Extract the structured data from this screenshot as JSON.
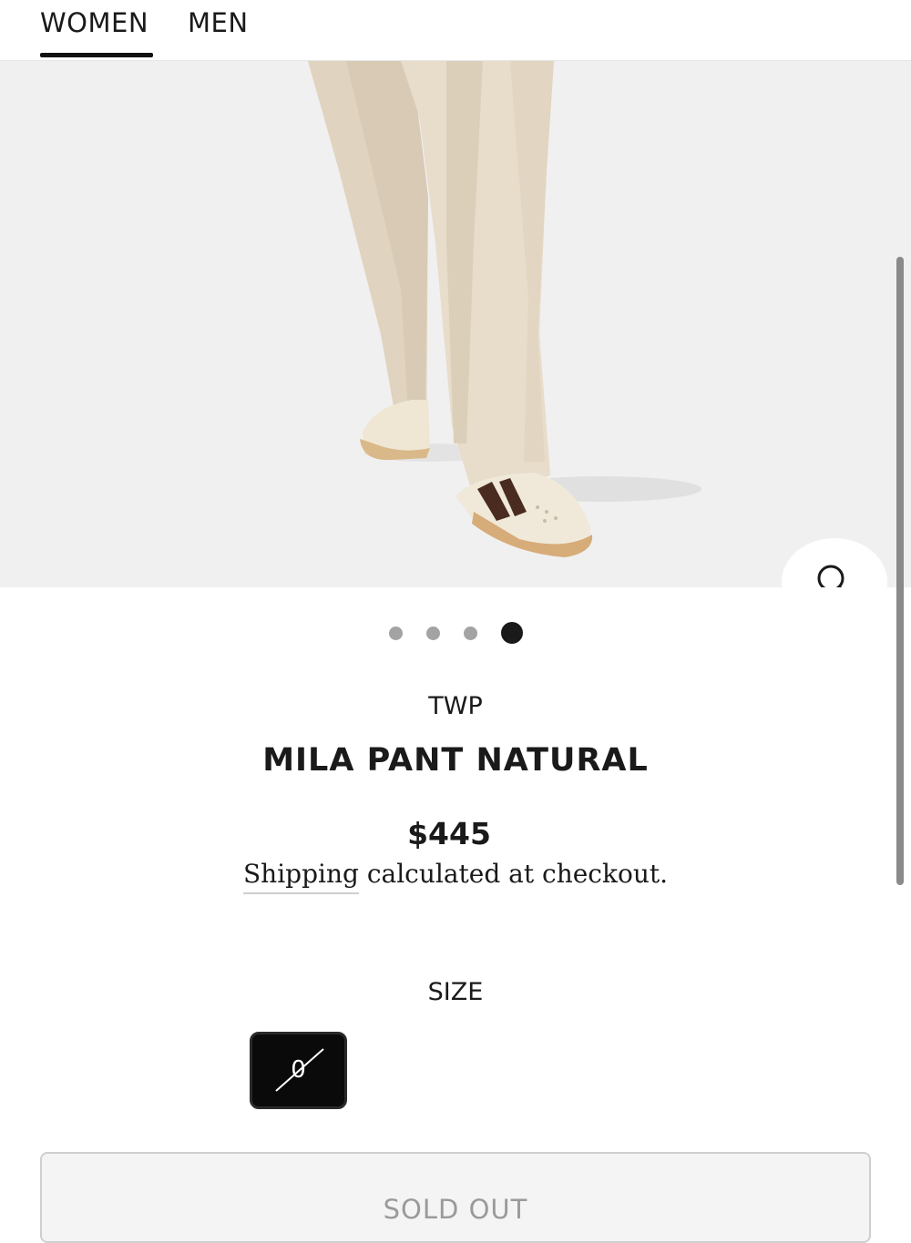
{
  "nav": {
    "tabs": [
      {
        "label": "WOMEN",
        "active": true
      },
      {
        "label": "MEN",
        "active": false
      }
    ]
  },
  "gallery": {
    "slide_count": 4,
    "active_slide": 4,
    "zoom_icon": "search-icon"
  },
  "product": {
    "brand": "TWP",
    "title": "MILA PANT NATURAL",
    "price": "$445",
    "shipping_link": "Shipping",
    "shipping_rest": " calculated at checkout."
  },
  "size": {
    "label": "SIZE",
    "options": [
      {
        "value": "0",
        "selected": true,
        "unavailable": true
      }
    ]
  },
  "cta": {
    "label": "SOLD OUT",
    "disabled": true
  },
  "colors": {
    "image_background": "#f0f0f0",
    "pant": "#e8dccb",
    "accent": "#1a1a1a"
  }
}
